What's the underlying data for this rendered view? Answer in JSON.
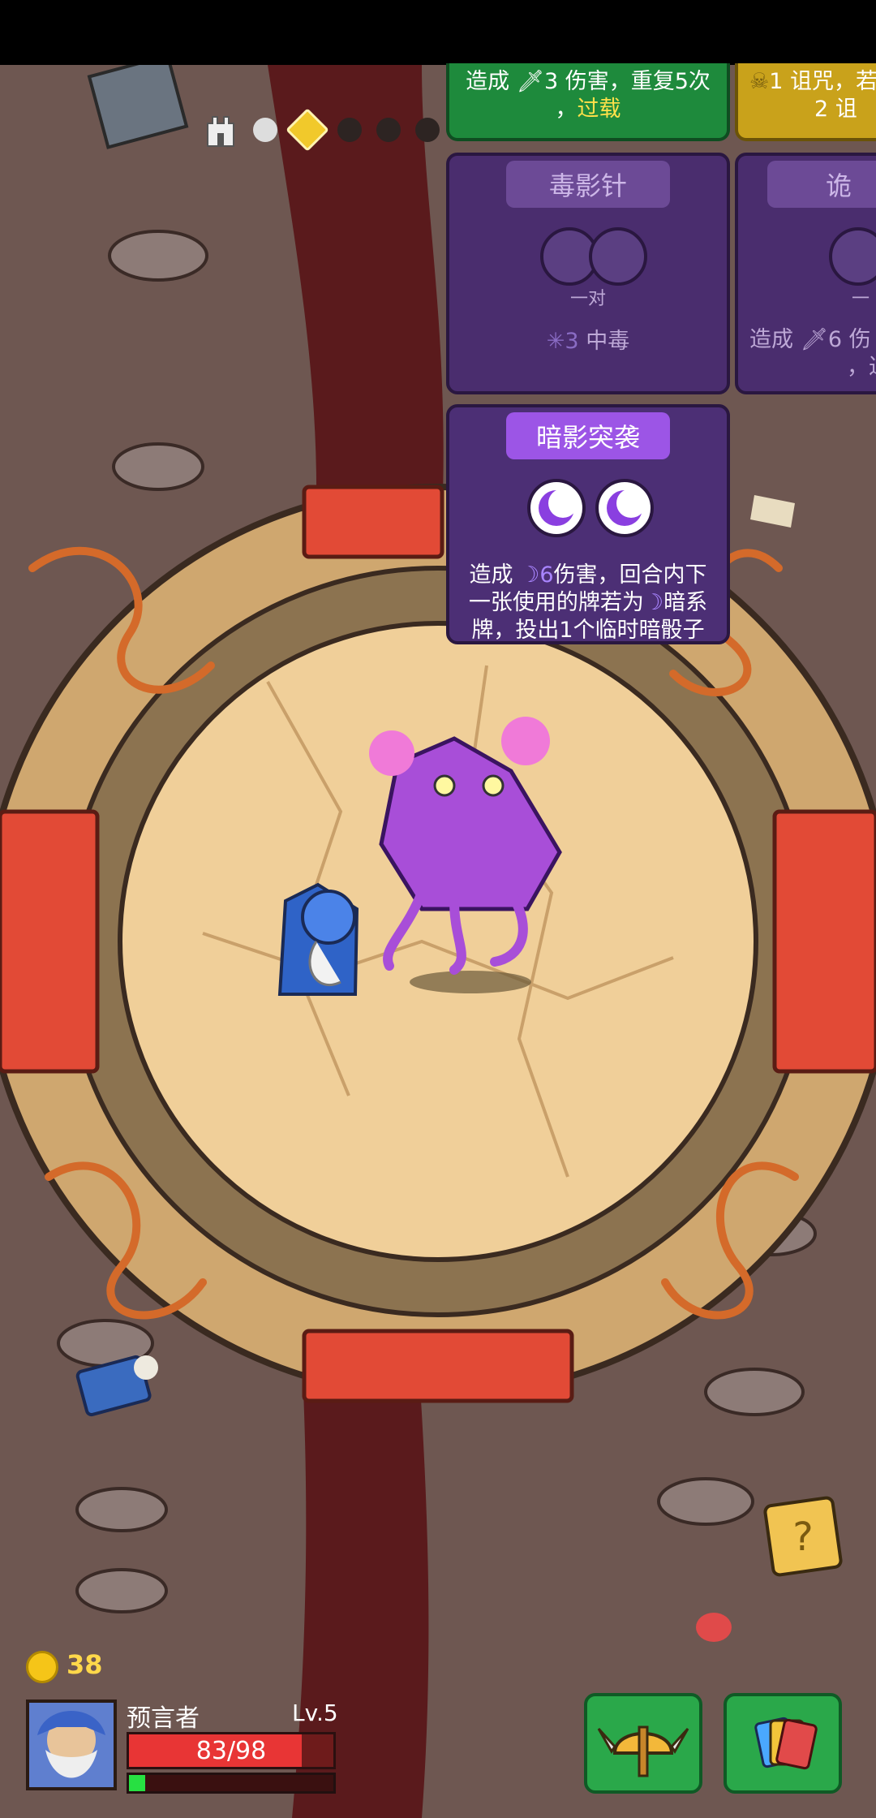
{
  "progress": {
    "tower_icon": "tower-icon",
    "nodes": [
      "done",
      "current",
      "locked",
      "locked",
      "locked"
    ]
  },
  "cards": {
    "attack_card": {
      "desc_prefix": "造成",
      "desc_icon": "sword-icon",
      "desc_value": "3",
      "desc_mid": "伤害，重复5次",
      "desc_sep": "，",
      "desc_kw": "过载"
    },
    "curse_card": {
      "num": "1",
      "line1": "诅咒，若",
      "num2": "2",
      "line2": "诅"
    },
    "poison_card": {
      "title": "毒影针",
      "slot_label": "一对",
      "poison_value": "3",
      "poison_text": "中毒",
      "poison_icon": "poison-icon"
    },
    "partial_card": {
      "title": "诡",
      "slot_label": "一",
      "desc_prefix": "造成",
      "desc_value": "6",
      "desc_rest": "伤",
      "desc_line2": "，过"
    },
    "shadow_card": {
      "title": "暗影突袭",
      "dice_icon": "moon-dice-icon",
      "desc_a": "造成",
      "desc_value": "6",
      "desc_b": "伤害，回合内下一张使用的牌若为",
      "desc_c": "暗系牌，投出1个临时暗骰子"
    }
  },
  "hud": {
    "coins": "38",
    "hero_name": "预言者",
    "level": "Lv.5",
    "hp_text": "83/98",
    "hp_fraction": 0.847,
    "xp_fraction": 0.08,
    "inventory_icon": "helmet-icon",
    "deck_icon": "cards-icon",
    "help_icon": "question-icon"
  },
  "colors": {
    "card_purple": "#4a2d6e",
    "card_green": "#1e8a3c",
    "card_gold": "#c9a21b",
    "hp": "#e83535",
    "xp": "#27e042",
    "coin": "#f5c518"
  }
}
